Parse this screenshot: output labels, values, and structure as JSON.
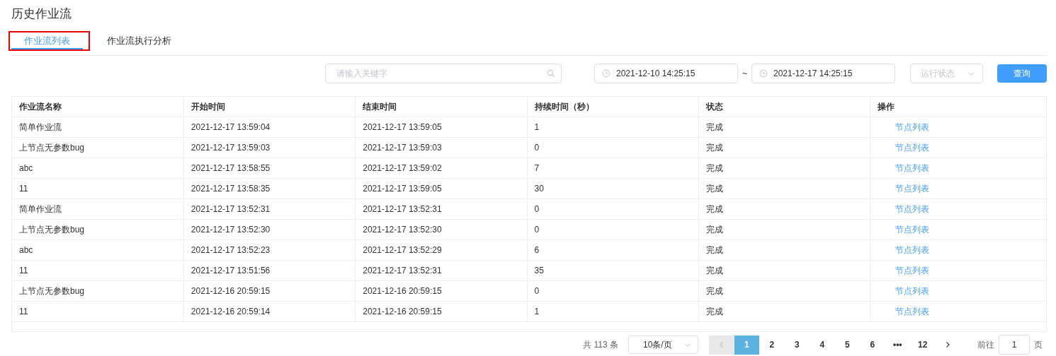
{
  "page_title": "历史作业流",
  "tabs": [
    {
      "label": "作业流列表",
      "selected": true,
      "highlighted": true
    },
    {
      "label": "作业流执行分析",
      "selected": false,
      "highlighted": false
    }
  ],
  "filters": {
    "search": {
      "placeholder": "请输入关键字"
    },
    "start_date": "2021-12-10 14:25:15",
    "range_separator": "~",
    "end_date": "2021-12-17 14:25:15",
    "status_select": {
      "placeholder": "运行状态"
    },
    "query_button": "查询"
  },
  "table": {
    "columns": [
      "作业流名称",
      "开始时间",
      "结束时间",
      "持续时间（秒）",
      "状态",
      "操作"
    ],
    "rows": [
      [
        "简单作业流",
        "2021-12-17 13:59:04",
        "2021-12-17 13:59:05",
        "1",
        "完成",
        "节点列表"
      ],
      [
        "上节点无参数bug",
        "2021-12-17 13:59:03",
        "2021-12-17 13:59:03",
        "0",
        "完成",
        "节点列表"
      ],
      [
        "abc",
        "2021-12-17 13:58:55",
        "2021-12-17 13:59:02",
        "7",
        "完成",
        "节点列表"
      ],
      [
        "11",
        "2021-12-17 13:58:35",
        "2021-12-17 13:59:05",
        "30",
        "完成",
        "节点列表"
      ],
      [
        "简单作业流",
        "2021-12-17 13:52:31",
        "2021-12-17 13:52:31",
        "0",
        "完成",
        "节点列表"
      ],
      [
        "上节点无参数bug",
        "2021-12-17 13:52:30",
        "2021-12-17 13:52:30",
        "0",
        "完成",
        "节点列表"
      ],
      [
        "abc",
        "2021-12-17 13:52:23",
        "2021-12-17 13:52:29",
        "6",
        "完成",
        "节点列表"
      ],
      [
        "11",
        "2021-12-17 13:51:56",
        "2021-12-17 13:52:31",
        "35",
        "完成",
        "节点列表"
      ],
      [
        "上节点无参数bug",
        "2021-12-16 20:59:15",
        "2021-12-16 20:59:15",
        "0",
        "完成",
        "节点列表"
      ],
      [
        "11",
        "2021-12-16 20:59:14",
        "2021-12-16 20:59:15",
        "1",
        "完成",
        "节点列表"
      ]
    ]
  },
  "pagination": {
    "total": "共 113 条",
    "page_size": "10条/页",
    "pages": [
      {
        "label": "1",
        "selected": true
      },
      {
        "label": "2",
        "selected": false
      },
      {
        "label": "3",
        "selected": false
      },
      {
        "label": "4",
        "selected": false
      },
      {
        "label": "5",
        "selected": false
      },
      {
        "label": "6",
        "selected": false
      },
      {
        "label": "•••",
        "selected": false
      },
      {
        "label": "12",
        "selected": false
      }
    ],
    "prev_disabled": true,
    "goto_label": "前往",
    "goto_value": "1",
    "page_suffix": "页"
  }
}
